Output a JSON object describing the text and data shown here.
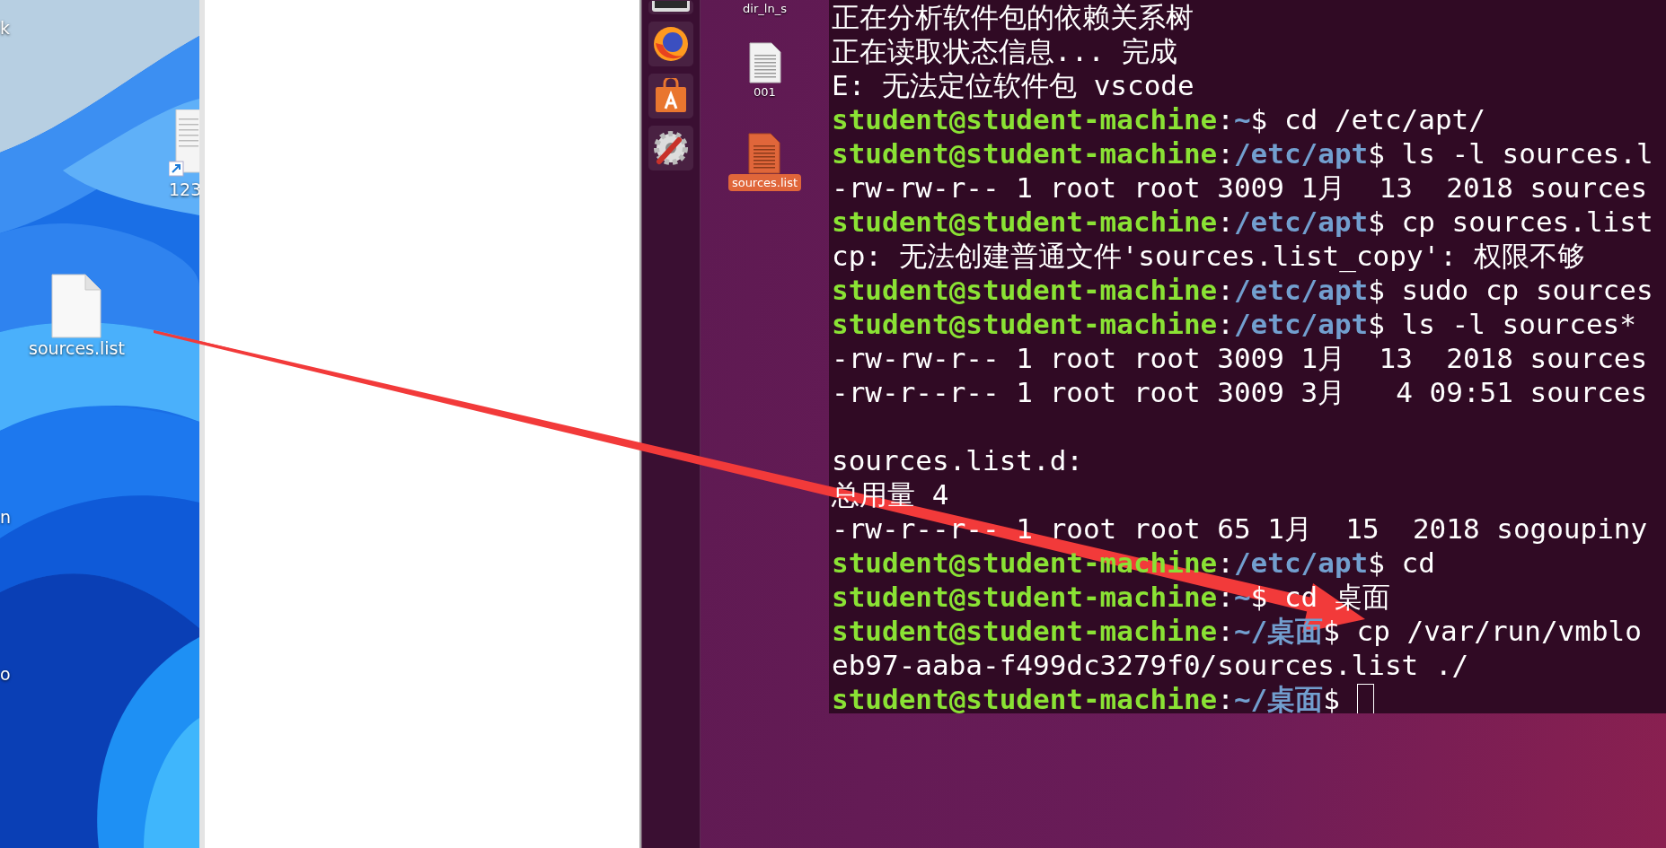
{
  "windows_desktop": {
    "edge_labels": [
      "k",
      "n",
      "o"
    ],
    "icons": [
      {
        "label": "123",
        "kind": "shortcut"
      },
      {
        "label": "sources.list",
        "kind": "file"
      }
    ]
  },
  "dock": {
    "items": [
      {
        "kind": "monitor"
      },
      {
        "kind": "browser"
      },
      {
        "kind": "store"
      },
      {
        "kind": "tools"
      }
    ]
  },
  "ubuntu_desktop": {
    "icons": [
      {
        "label": "dir_ln_s",
        "kind": "cut",
        "selected": false
      },
      {
        "label": "001",
        "kind": "text",
        "selected": false
      },
      {
        "label": "sources.list",
        "kind": "text",
        "selected": true
      }
    ]
  },
  "terminal": {
    "lines": [
      {
        "kind": "output",
        "text": "正在分析软件包的依赖关系树"
      },
      {
        "kind": "output",
        "text": "正在读取状态信息... 完成"
      },
      {
        "kind": "output",
        "text": "E: 无法定位软件包 vscode"
      },
      {
        "kind": "prompt",
        "user": "student@student-machine",
        "colon": ":",
        "path": "~",
        "sign": "$",
        "command": "cd /etc/apt/"
      },
      {
        "kind": "prompt",
        "user": "student@student-machine",
        "colon": ":",
        "path": "/etc/apt",
        "sign": "$",
        "command": "ls -l sources.l"
      },
      {
        "kind": "output",
        "text": "-rw-rw-r-- 1 root root 3009 1月  13  2018 sources"
      },
      {
        "kind": "prompt",
        "user": "student@student-machine",
        "colon": ":",
        "path": "/etc/apt",
        "sign": "$",
        "command": "cp sources.list"
      },
      {
        "kind": "output",
        "text": "cp: 无法创建普通文件'sources.list_copy': 权限不够"
      },
      {
        "kind": "prompt",
        "user": "student@student-machine",
        "colon": ":",
        "path": "/etc/apt",
        "sign": "$",
        "command": "sudo cp sources"
      },
      {
        "kind": "prompt",
        "user": "student@student-machine",
        "colon": ":",
        "path": "/etc/apt",
        "sign": "$",
        "command": "ls -l sources*"
      },
      {
        "kind": "output",
        "text": "-rw-rw-r-- 1 root root 3009 1月  13  2018 sources"
      },
      {
        "kind": "output",
        "text": "-rw-r--r-- 1 root root 3009 3月   4 09:51 sources"
      },
      {
        "kind": "blank"
      },
      {
        "kind": "output",
        "text": "sources.list.d:"
      },
      {
        "kind": "output",
        "text": "总用量 4"
      },
      {
        "kind": "output",
        "text": "-rw-r--r-- 1 root root 65 1月  15  2018 sogoupiny"
      },
      {
        "kind": "prompt",
        "user": "student@student-machine",
        "colon": ":",
        "path": "/etc/apt",
        "sign": "$",
        "command": "cd"
      },
      {
        "kind": "prompt",
        "user": "student@student-machine",
        "colon": ":",
        "path": "~",
        "sign": "$",
        "command": "cd 桌面"
      },
      {
        "kind": "prompt",
        "user": "student@student-machine",
        "colon": ":",
        "path": "~/桌面",
        "sign": "$",
        "command": "cp /var/run/vmblo"
      },
      {
        "kind": "output",
        "text": "eb97-aaba-f499dc3279f0/sources.list ./"
      },
      {
        "kind": "prompt",
        "user": "student@student-machine",
        "colon": ":",
        "path": "~/桌面",
        "sign": "$",
        "cursor": true
      }
    ]
  }
}
